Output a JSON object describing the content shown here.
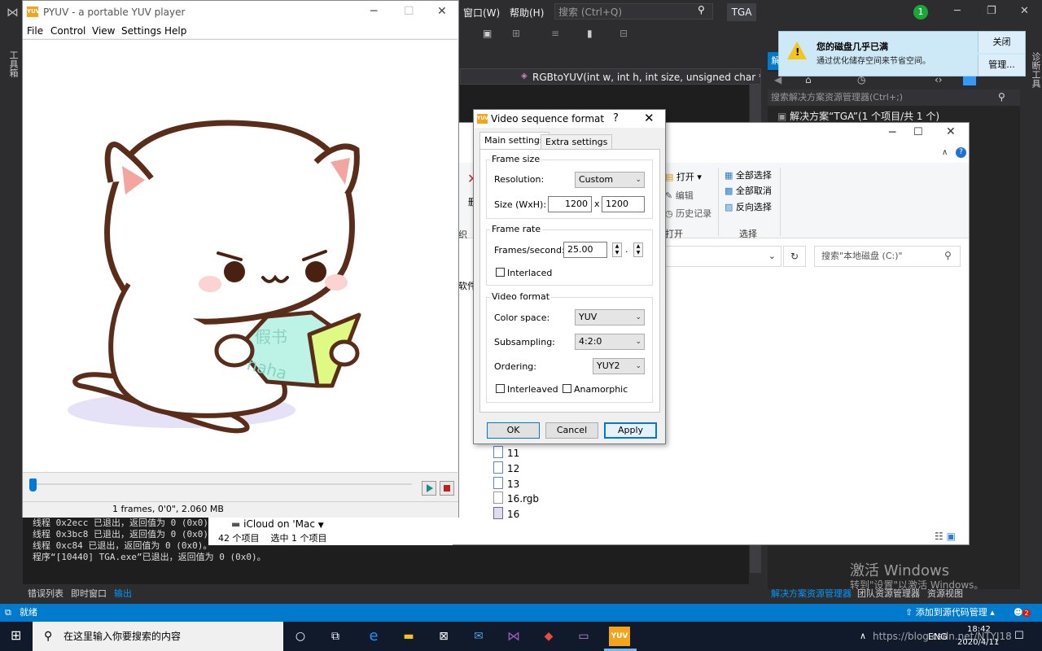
{
  "vs": {
    "menu": [
      "窗口(W)",
      "帮助(H)"
    ],
    "search_placeholder": "搜索 (Ctrl+Q)",
    "project_badge": "TGA",
    "notification_count": "1",
    "left_tool_label": "工具箱",
    "function_nav": "RGBtoYUV(int w, int h, int size, unsigned char * RED_",
    "output_lines": [
      "线程 0x2ecc 已退出，返回值为 0 (0x0)。",
      "线程 0x3bc8 已退出，返回值为 0 (0x0)。",
      "线程 0xc84 已退出，返回值为 0 (0x0)。",
      "程序“[10440] TGA.exe”已退出，返回值为 0 (0x0)。"
    ],
    "bottom_tabs": [
      "错误列表",
      "即时窗口",
      "输出"
    ],
    "solution_header": "解",
    "solution_search": "搜索解决方案资源管理器(Ctrl+;)",
    "solution_root": "解决方案“TGA”(1 个项目/共 1 个)",
    "solution_tabs": [
      "解决方案资源管理器",
      "团队资源管理器",
      "资源视图"
    ],
    "right_strip_label": "诊断工具",
    "status_ready": "就绪",
    "status_source_control": "添加到源代码管理",
    "status_notif": "2",
    "watermark_title": "激活 Windows",
    "watermark_sub": "转到\"设置\"以激活 Windows。"
  },
  "toast": {
    "title": "您的磁盘几乎已满",
    "body": "通过优化储存空间来节省空间。",
    "close": "关闭",
    "manage": "管理..."
  },
  "explorer": {
    "ribbon_open_label": "打开",
    "ribbon_edit": "编辑",
    "ribbon_history": "历史记录",
    "ribbon_group_open": "打开",
    "ribbon_select_all": "全部选择",
    "ribbon_select_none": "全部取消",
    "ribbon_invert": "反向选择",
    "ribbon_group_select": "选择",
    "ribbon_left_fragment_1": "删",
    "ribbon_left_fragment_2": "织",
    "side_fragment": "软件",
    "search_placeholder": "搜索\"本地磁盘 (C:)\"",
    "files": [
      "11",
      "12",
      "13",
      "16.rgb",
      "16"
    ],
    "icloud": "iCloud on 'Mac",
    "status_items": "42 个项目",
    "status_selected": "选中 1 个项目"
  },
  "pyuv": {
    "title": "PYUV - a portable YUV player",
    "logo": "YUV",
    "menu": [
      "File",
      "Control",
      "View",
      "Settings",
      "Help"
    ],
    "status": "1 frames, 0'0\", 2.060 MB",
    "book_text_1": "假书",
    "book_text_2": "haha"
  },
  "dialog": {
    "title": "Video sequence format",
    "help": "?",
    "tabs": [
      "Main settings",
      "Extra settings"
    ],
    "frame_size": {
      "group": "Frame size",
      "resolution_label": "Resolution:",
      "resolution_value": "Custom",
      "size_label": "Size (WxH):",
      "width": "1200",
      "x": "x",
      "height": "1200"
    },
    "frame_rate": {
      "group": "Frame rate",
      "fps_label": "Frames/second:",
      "fps_value": "25.00",
      "dot": ".",
      "interlaced": "Interlaced"
    },
    "video_format": {
      "group": "Video format",
      "color_space_label": "Color space:",
      "color_space": "YUV",
      "subsampling_label": "Subsampling:",
      "subsampling": "4:2:0",
      "ordering_label": "Ordering:",
      "ordering": "YUY2",
      "interleaved": "Interleaved",
      "anamorphic": "Anamorphic"
    },
    "buttons": {
      "ok": "OK",
      "cancel": "Cancel",
      "apply": "Apply"
    }
  },
  "taskbar": {
    "search_placeholder": "在这里输入你要搜索的内容",
    "url_overlay": "https://blog.csdn.net/NTYJ18",
    "lang": "ENG",
    "time": "18:42",
    "date": "2020/4/11"
  },
  "colors": {
    "vs_bg": "#2d2d30",
    "vs_accent": "#007acc",
    "dialog_default_button": "#0078d7",
    "toast_bg": "#cde8f6"
  }
}
